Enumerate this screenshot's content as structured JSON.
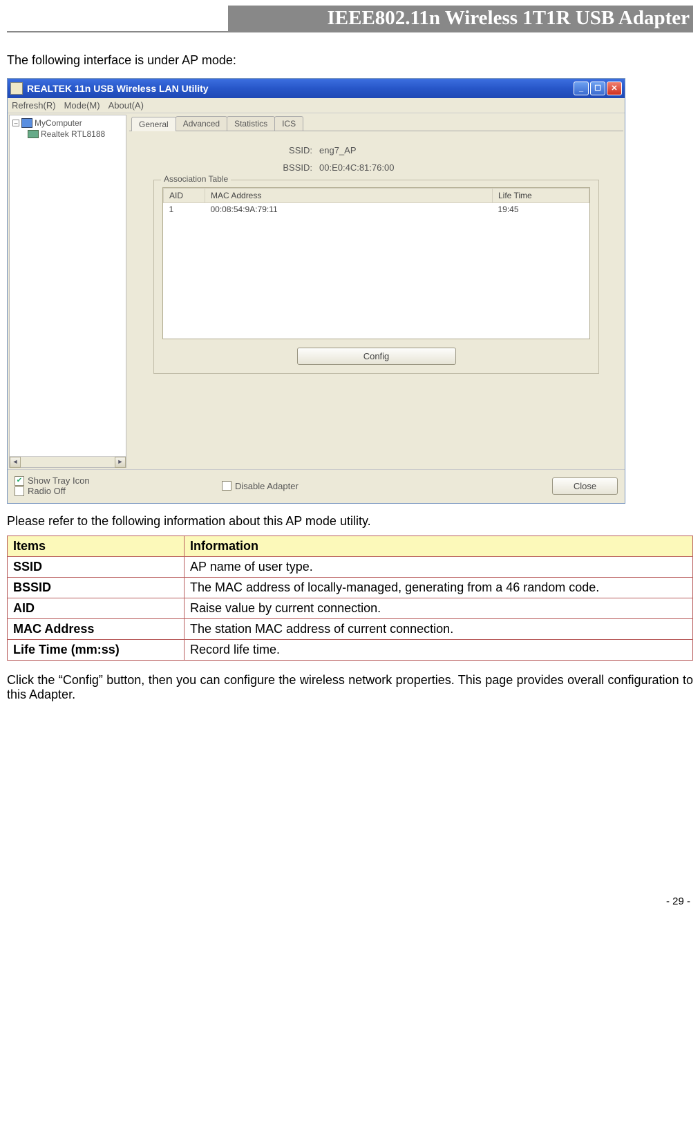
{
  "header": {
    "title": "IEEE802.11n Wireless 1T1R USB Adapter"
  },
  "intro": "The following interface is under AP mode:",
  "screenshot": {
    "title": "REALTEK 11n USB Wireless LAN Utility",
    "menu": {
      "refresh": "Refresh(R)",
      "mode": "Mode(M)",
      "about": "About(A)"
    },
    "tree": {
      "root": "MyComputer",
      "child": "Realtek RTL8188"
    },
    "tabs": {
      "general": "General",
      "advanced": "Advanced",
      "statistics": "Statistics",
      "ics": "ICS"
    },
    "form": {
      "ssid_label": "SSID:",
      "ssid_value": "eng7_AP",
      "bssid_label": "BSSID:",
      "bssid_value": "00:E0:4C:81:76:00"
    },
    "assoc": {
      "group_title": "Association Table",
      "headers": {
        "aid": "AID",
        "mac": "MAC Address",
        "life": "Life Time"
      },
      "row": {
        "aid": "1",
        "mac": "00:08:54:9A:79:11",
        "life": "19:45"
      }
    },
    "config_btn": "Config",
    "bottom": {
      "show_tray": "Show Tray Icon",
      "radio_off": "Radio Off",
      "disable_adapter": "Disable Adapter",
      "close": "Close"
    }
  },
  "info_intro": "Please refer to the following information about this AP mode utility.",
  "info_table": {
    "head_items": "Items",
    "head_info": "Information",
    "rows": [
      {
        "item": "SSID",
        "info": "AP name of user type."
      },
      {
        "item": "BSSID",
        "info": "The MAC address of locally-managed, generating from a 46 random code."
      },
      {
        "item": "AID",
        "info": "Raise value by current connection."
      },
      {
        "item": "MAC Address",
        "info": "The station MAC address of current connection."
      },
      {
        "item": "Life Time (mm:ss)",
        "info": "Record life time."
      }
    ]
  },
  "closing": "Click the “Config” button, then you can configure the wireless network properties. This page provides overall configuration to this Adapter.",
  "page_num": "- 29 -"
}
